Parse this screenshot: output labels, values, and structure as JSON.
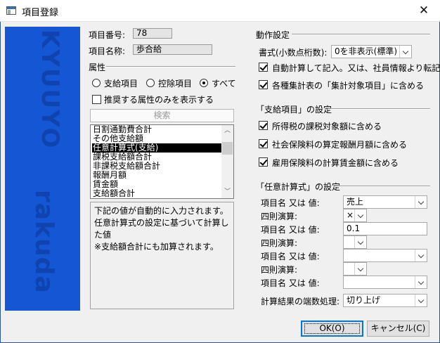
{
  "window": {
    "title": "項目登録",
    "close": "✕"
  },
  "banner": {
    "text_top": "KYUUYO",
    "text_bottom": "rakuda"
  },
  "item": {
    "number_label": "項目番号:",
    "number_value": "78",
    "name_label": "項目名称:",
    "name_value": "歩合給"
  },
  "attributes": {
    "header": "属性",
    "radios": [
      {
        "label": "支給項目",
        "checked": false
      },
      {
        "label": "控除項目",
        "checked": false
      },
      {
        "label": "すべて",
        "checked": true
      }
    ],
    "recommended_label": "推奨する属性のみを表示する",
    "recommended_checked": false,
    "search_button": "検索",
    "list": [
      "日割通勤費合計",
      "その他支給額",
      "任意計算式(支給)",
      "課税支給額合計",
      "非課税支給額合計",
      "報酬月額",
      "賃金額",
      "支給額合計"
    ],
    "selected_index": 2,
    "description": [
      "下記の値が自動的に入力されます。",
      "任意計算式の設定に基づいて計算し",
      "た値",
      "※支給額合計にも加算されます。"
    ]
  },
  "settings": {
    "header": "動作設定",
    "format_label": "書式(小数点桁数):",
    "format_value": "0を非表示(標準)",
    "checks": [
      {
        "label": "自動計算して記入。又は、社員情報より転記",
        "checked": true
      },
      {
        "label": "各種集計表の「集計対象項目」に含める",
        "checked": true
      }
    ]
  },
  "payment": {
    "header": "「支給項目」の設定",
    "checks": [
      {
        "label": "所得税の課税対象額に含める",
        "checked": true
      },
      {
        "label": "社会保険料の算定報酬月額に含める",
        "checked": true
      },
      {
        "label": "雇用保険料の計算賃金額に含める",
        "checked": true
      }
    ]
  },
  "formula": {
    "header": "「任意計算式」の設定",
    "item_label": "項目名 又は 値:",
    "op_label": "四則演算:",
    "item1": "売上",
    "op1": "×",
    "item2": "0.1",
    "op2": "",
    "item3": "",
    "op3": "",
    "item4": "",
    "rounding_label": "計算結果の端数処理:",
    "rounding_value": "切り上げ"
  },
  "buttons": {
    "ok": "OK(O)",
    "cancel": "キャンセル(C)"
  },
  "colors": {
    "banner": "#1556d4",
    "banner_text": "#0e43b0",
    "accent": "#0078d7"
  }
}
